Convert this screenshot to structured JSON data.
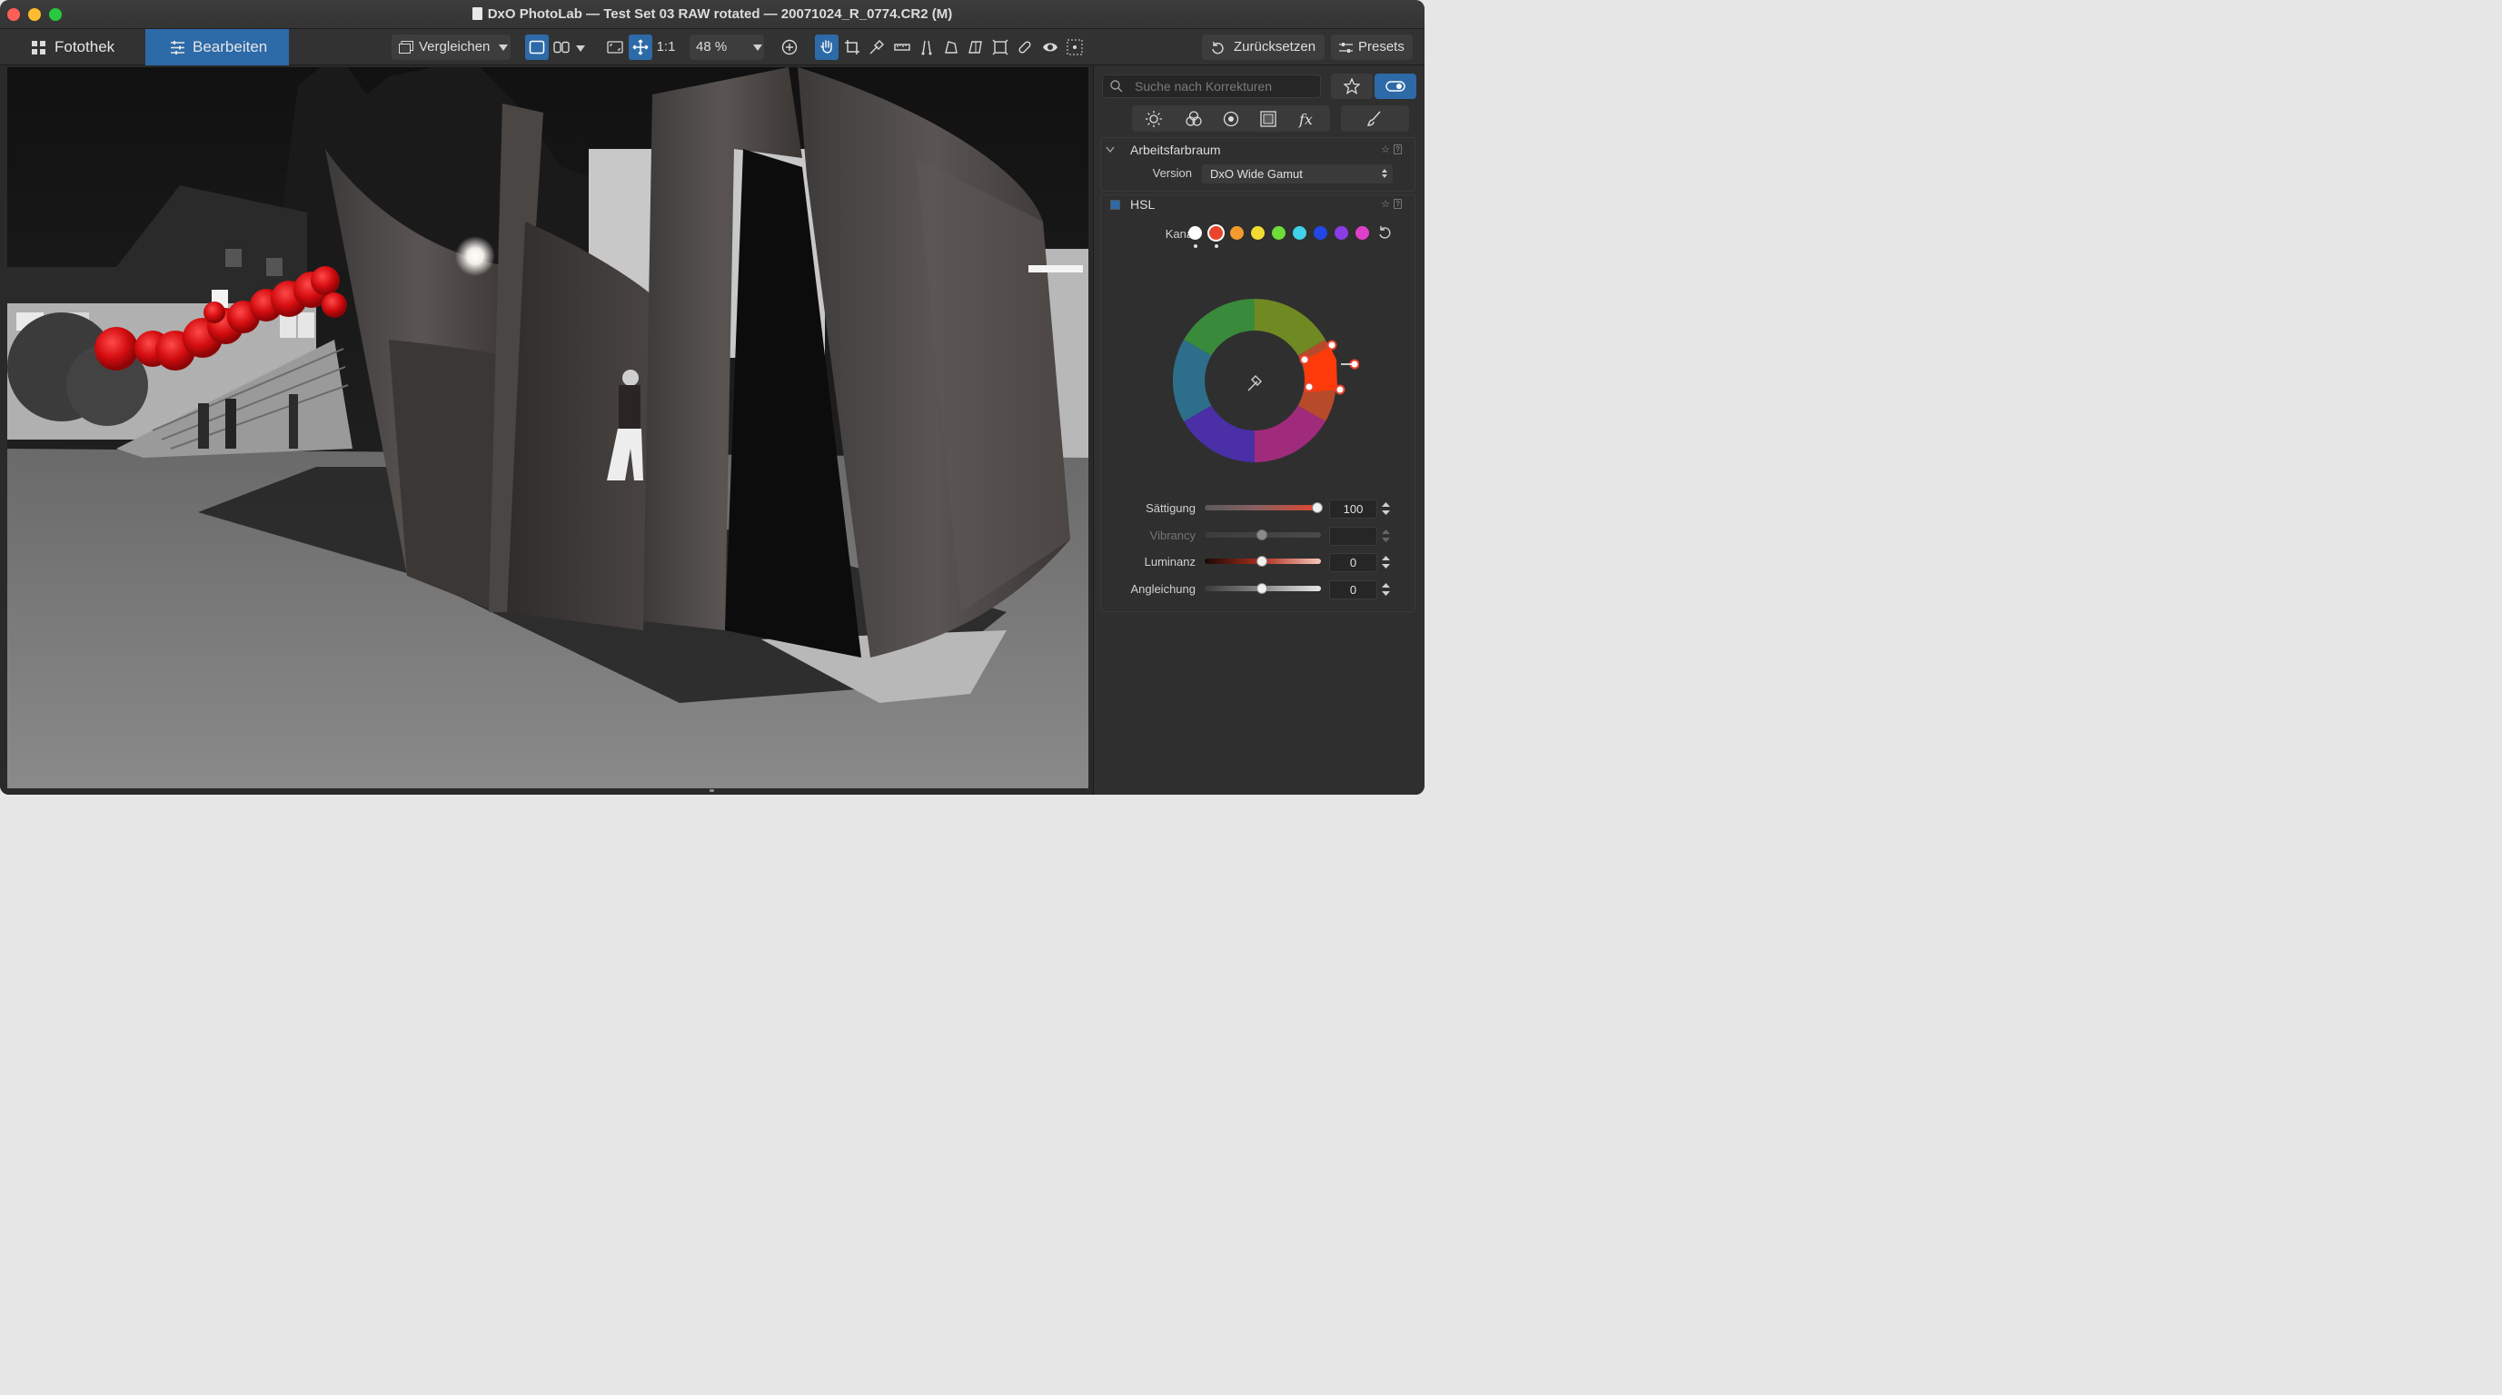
{
  "window": {
    "title": "DxO PhotoLab — Test Set 03 RAW rotated — 20071024_R_0774.CR2 (M)"
  },
  "toolbar": {
    "tab_library": "Fotothek",
    "tab_edit": "Bearbeiten",
    "compare_label": "Vergleichen",
    "one_to_one": "1:1",
    "zoom": "48 %",
    "reset_label": "Zurücksetzen",
    "presets_label": "Presets"
  },
  "panel": {
    "search_placeholder": "Suche nach Korrekturen",
    "working_color_space": {
      "title": "Arbeitsfarbraum",
      "version_label": "Version",
      "version_value": "DxO Wide Gamut"
    },
    "hsl": {
      "title": "HSL",
      "channel_label": "Kanal",
      "channels": [
        {
          "name": "all",
          "color": "#ffffff",
          "selected": false
        },
        {
          "name": "red",
          "color": "#e8432b",
          "selected": true
        },
        {
          "name": "orange",
          "color": "#f39a2c",
          "selected": false
        },
        {
          "name": "yellow",
          "color": "#f1dc34",
          "selected": false
        },
        {
          "name": "green",
          "color": "#6fdc3a",
          "selected": false
        },
        {
          "name": "cyan",
          "color": "#3fd2e8",
          "selected": false
        },
        {
          "name": "blue",
          "color": "#2247e6",
          "selected": false
        },
        {
          "name": "purple",
          "color": "#8a3de6",
          "selected": false
        },
        {
          "name": "magenta",
          "color": "#e03fc9",
          "selected": false
        }
      ],
      "sliders": [
        {
          "label": "Sättigung",
          "value": "100",
          "fraction": 1.0,
          "enabled": true
        },
        {
          "label": "Vibrancy",
          "value": "",
          "fraction": 0.5,
          "enabled": false
        },
        {
          "label": "Luminanz",
          "value": "0",
          "fraction": 0.5,
          "enabled": true
        },
        {
          "label": "Angleichung",
          "value": "0",
          "fraction": 0.5,
          "enabled": true
        }
      ]
    }
  },
  "colors": {
    "accent": "#2d6aa8",
    "panel_bg": "#2f2f2f"
  }
}
